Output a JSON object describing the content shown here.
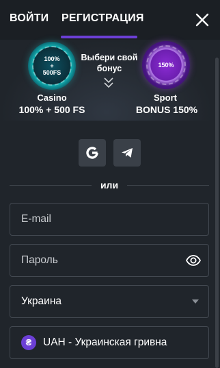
{
  "tabs": {
    "login": "ВОЙТИ",
    "register": "РЕГИСТРАЦИЯ",
    "active": "register"
  },
  "icons": {
    "close": "close-icon",
    "google": "google-icon",
    "telegram": "telegram-icon",
    "show_password": "eye-icon",
    "dropdown": "triangle-down-icon",
    "currency": "hryvnia-icon",
    "chevrons": "double-chevron-down-icon"
  },
  "promo": {
    "choose_bonus": "Выбери свой бонус",
    "casino": {
      "title": "Casino",
      "value": "100% + 500 FS",
      "badge_top": "100%",
      "badge_plus": "+",
      "badge_bottom": "500FS",
      "badge_ring": "FIRST DEPOSIT"
    },
    "sport": {
      "title": "Sport",
      "value": "BONUS 150%",
      "badge_center": "150%",
      "badge_ring_top": "SPORT BONUS",
      "badge_ring_bottom": "FIRST DEPOSIT"
    }
  },
  "divider": {
    "label": "или"
  },
  "form": {
    "email": {
      "placeholder": "E-mail",
      "value": ""
    },
    "password": {
      "placeholder": "Пароль",
      "value": ""
    },
    "country": {
      "value": "Украина"
    },
    "currency": {
      "symbol": "₴",
      "value": "UAH - Украинская гривна"
    }
  },
  "colors": {
    "background": "#20252b",
    "header": "#1b1f24",
    "accent": "#6c3fd6",
    "field_border": "#434951",
    "social_button": "#3a4048"
  }
}
